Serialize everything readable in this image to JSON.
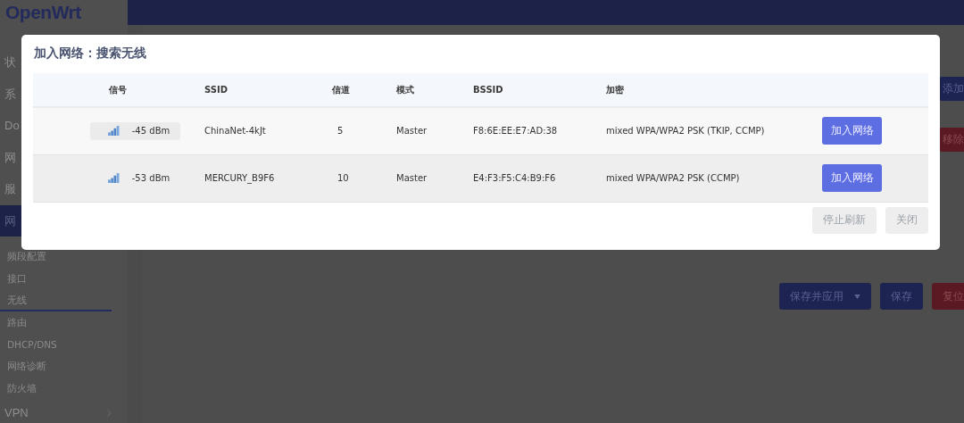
{
  "logo": "OpenWrt",
  "sidebar": {
    "items": [
      {
        "label": "状",
        "selected": false
      },
      {
        "label": "系",
        "selected": false
      },
      {
        "label": "Do",
        "selected": false
      },
      {
        "label": "网",
        "selected": false
      },
      {
        "label": "服",
        "selected": false
      },
      {
        "label": "网",
        "selected": true,
        "children": [
          {
            "label": "频段配置",
            "selected": false
          },
          {
            "label": "接口",
            "selected": false
          },
          {
            "label": "无线",
            "selected": true
          },
          {
            "label": "路由",
            "selected": false
          },
          {
            "label": "DHCP/DNS",
            "selected": false
          },
          {
            "label": "网络诊断",
            "selected": false
          },
          {
            "label": "防火墙",
            "selected": false
          }
        ]
      },
      {
        "label": "VPN",
        "selected": false,
        "expandable": true
      }
    ]
  },
  "side_buttons": [
    {
      "label": "添加",
      "kind": "primary"
    },
    {
      "label": "移除",
      "kind": "danger"
    }
  ],
  "footer_buttons": [
    {
      "label": "保存并应用",
      "kind": "primary",
      "dropdown": true
    },
    {
      "label": "保存",
      "kind": "primary",
      "dropdown": false
    },
    {
      "label": "复位",
      "kind": "danger"
    }
  ],
  "dialog": {
    "title": "加入网络：搜索无线",
    "table": {
      "columns": [
        "信号",
        "SSID",
        "信道",
        "模式",
        "BSSID",
        "加密"
      ],
      "rows": [
        {
          "signal": "-45 dBm",
          "hovered": true,
          "ssid": "ChinaNet-4kJt",
          "channel": "5",
          "mode": "Master",
          "bssid": "F8:6E:EE:E7:AD:38",
          "encryption": "mixed WPA/WPA2 PSK (TKIP, CCMP)",
          "action": "加入网络"
        },
        {
          "signal": "-53 dBm",
          "hovered": false,
          "ssid": "MERCURY_B9F6",
          "channel": "10",
          "mode": "Master",
          "bssid": "E4:F3:F5:C4:B9:F6",
          "encryption": "mixed WPA/WPA2 PSK (CCMP)",
          "action": "加入网络"
        }
      ]
    },
    "buttons": [
      "停止刷新",
      "关闭"
    ]
  }
}
